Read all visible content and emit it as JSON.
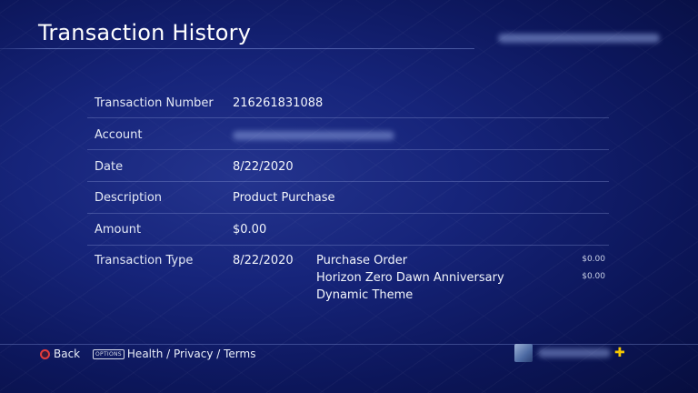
{
  "header": {
    "title": "Transaction History"
  },
  "details": {
    "transaction_number_label": "Transaction Number",
    "transaction_number": "216261831088",
    "account_label": "Account",
    "date_label": "Date",
    "date": "8/22/2020",
    "description_label": "Description",
    "description": "Product Purchase",
    "amount_label": "Amount",
    "amount": "$0.00",
    "type_label": "Transaction Type",
    "type_date": "8/22/2020",
    "items": [
      {
        "name": "Purchase Order",
        "price": "$0.00"
      },
      {
        "name": "Horizon Zero Dawn Anniversary",
        "price": "$0.00"
      },
      {
        "name": "Dynamic Theme",
        "price": ""
      }
    ]
  },
  "footer": {
    "back_label": "Back",
    "options_badge": "OPTIONS",
    "links_label": "Health / Privacy / Terms"
  },
  "colors": {
    "background": "#16247a",
    "circle_button": "#e23c3c",
    "plus": "#f6c800"
  },
  "icons": [
    "circle-button-icon",
    "options-button-icon",
    "ps-plus-icon"
  ]
}
